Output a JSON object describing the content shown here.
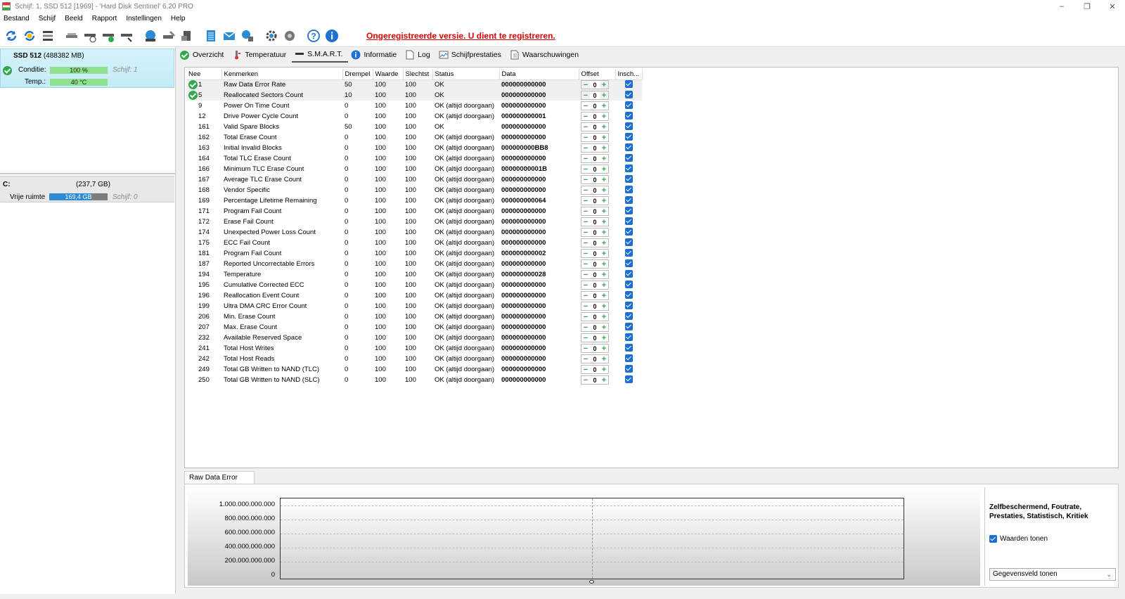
{
  "window": {
    "title": "Schijf: 1, SSD 512 [1969]  -  'Hard Disk Sentinel' 6.20 PRO",
    "controls": [
      "–",
      "❐",
      "✕"
    ]
  },
  "menu": [
    "Bestand",
    "Schijf",
    "Beeld",
    "Rapport",
    "Instellingen",
    "Help"
  ],
  "toolbar": {
    "icons": [
      "refresh-icon",
      "refresh-all-icon",
      "disk-list-icon",
      "disk-gray-icon",
      "disk-clock-icon",
      "disk-check-icon",
      "disk-arrow-icon",
      "globe-disk-icon",
      "disk-tools-icon",
      "disk-stack-icon",
      "notepad-icon",
      "mail-icon",
      "network-icon",
      "gear-icon",
      "settings-speaker-icon",
      "help-icon",
      "info-icon"
    ],
    "registration_warning": "Ongeregistreerde versie. U dient te registreren."
  },
  "left": {
    "disk": {
      "name": "SSD 512",
      "size": "(488382 MB)",
      "condition_label": "Conditie:",
      "condition_value": "100 %",
      "condition_disk": "Schijf: 1",
      "temp_label": "Temp.:",
      "temp_value": "40 °C"
    },
    "volume": {
      "letter": "C:",
      "size": "(237,7 GB)",
      "free_label": "Vrije ruimte",
      "free_value": "169,4 GB",
      "free_fraction": 0.713,
      "disk": "Schijf: 0"
    }
  },
  "tabs": [
    {
      "label": "Overzicht",
      "icon": "check-icon"
    },
    {
      "label": "Temperatuur",
      "icon": "thermometer-icon"
    },
    {
      "label": "S.M.A.R.T.",
      "icon": "smart-icon"
    },
    {
      "label": "Informatie",
      "icon": "info-icon"
    },
    {
      "label": "Log",
      "icon": "log-icon"
    },
    {
      "label": "Schijfprestaties",
      "icon": "performance-icon"
    },
    {
      "label": "Waarschuwingen",
      "icon": "warning-doc-icon"
    }
  ],
  "smart": {
    "headers": [
      "Nee",
      "Kenmerken",
      "Drempel",
      "Waarde",
      "Slechtst",
      "Status",
      "Data",
      "Offset",
      "Insch..."
    ],
    "rows": [
      {
        "id": "1",
        "name": "Raw Data Error Rate",
        "threshold": "50",
        "value": "100",
        "worst": "100",
        "status": "OK",
        "data": "000000000000",
        "offset": "0",
        "icon": true
      },
      {
        "id": "5",
        "name": "Reallocated Sectors Count",
        "threshold": "10",
        "value": "100",
        "worst": "100",
        "status": "OK",
        "data": "000000000000",
        "offset": "0",
        "icon": true
      },
      {
        "id": "9",
        "name": "Power On Time Count",
        "threshold": "0",
        "value": "100",
        "worst": "100",
        "status": "OK (altijd doorgaan)",
        "data": "000000000000",
        "offset": "0"
      },
      {
        "id": "12",
        "name": "Drive Power Cycle Count",
        "threshold": "0",
        "value": "100",
        "worst": "100",
        "status": "OK (altijd doorgaan)",
        "data": "000000000001",
        "offset": "0"
      },
      {
        "id": "161",
        "name": "Valid Spare Blocks",
        "threshold": "50",
        "value": "100",
        "worst": "100",
        "status": "OK",
        "data": "000000000000",
        "offset": "0"
      },
      {
        "id": "162",
        "name": "Total Erase Count",
        "threshold": "0",
        "value": "100",
        "worst": "100",
        "status": "OK (altijd doorgaan)",
        "data": "000000000000",
        "offset": "0"
      },
      {
        "id": "163",
        "name": "Initial Invalid Blocks",
        "threshold": "0",
        "value": "100",
        "worst": "100",
        "status": "OK (altijd doorgaan)",
        "data": "000000000BB8",
        "offset": "0"
      },
      {
        "id": "164",
        "name": "Total TLC Erase Count",
        "threshold": "0",
        "value": "100",
        "worst": "100",
        "status": "OK (altijd doorgaan)",
        "data": "000000000000",
        "offset": "0"
      },
      {
        "id": "166",
        "name": "Minimum TLC Erase Count",
        "threshold": "0",
        "value": "100",
        "worst": "100",
        "status": "OK (altijd doorgaan)",
        "data": "00000000001B",
        "offset": "0"
      },
      {
        "id": "167",
        "name": "Average TLC Erase Count",
        "threshold": "0",
        "value": "100",
        "worst": "100",
        "status": "OK (altijd doorgaan)",
        "data": "000000000000",
        "offset": "0"
      },
      {
        "id": "168",
        "name": "Vendor Specific",
        "threshold": "0",
        "value": "100",
        "worst": "100",
        "status": "OK (altijd doorgaan)",
        "data": "000000000000",
        "offset": "0"
      },
      {
        "id": "169",
        "name": "Percentage Lifetime Remaining",
        "threshold": "0",
        "value": "100",
        "worst": "100",
        "status": "OK (altijd doorgaan)",
        "data": "000000000064",
        "offset": "0"
      },
      {
        "id": "171",
        "name": "Program Fail Count",
        "threshold": "0",
        "value": "100",
        "worst": "100",
        "status": "OK (altijd doorgaan)",
        "data": "000000000000",
        "offset": "0"
      },
      {
        "id": "172",
        "name": "Erase Fail Count",
        "threshold": "0",
        "value": "100",
        "worst": "100",
        "status": "OK (altijd doorgaan)",
        "data": "000000000000",
        "offset": "0"
      },
      {
        "id": "174",
        "name": "Unexpected Power Loss Count",
        "threshold": "0",
        "value": "100",
        "worst": "100",
        "status": "OK (altijd doorgaan)",
        "data": "000000000000",
        "offset": "0"
      },
      {
        "id": "175",
        "name": "ECC Fail Count",
        "threshold": "0",
        "value": "100",
        "worst": "100",
        "status": "OK (altijd doorgaan)",
        "data": "000000000000",
        "offset": "0"
      },
      {
        "id": "181",
        "name": "Program Fail Count",
        "threshold": "0",
        "value": "100",
        "worst": "100",
        "status": "OK (altijd doorgaan)",
        "data": "000000000002",
        "offset": "0"
      },
      {
        "id": "187",
        "name": "Reported Uncorrectable Errors",
        "threshold": "0",
        "value": "100",
        "worst": "100",
        "status": "OK (altijd doorgaan)",
        "data": "000000000000",
        "offset": "0"
      },
      {
        "id": "194",
        "name": "Temperature",
        "threshold": "0",
        "value": "100",
        "worst": "100",
        "status": "OK (altijd doorgaan)",
        "data": "000000000028",
        "offset": "0"
      },
      {
        "id": "195",
        "name": "Cumulative Corrected ECC",
        "threshold": "0",
        "value": "100",
        "worst": "100",
        "status": "OK (altijd doorgaan)",
        "data": "000000000000",
        "offset": "0"
      },
      {
        "id": "196",
        "name": "Reallocation Event Count",
        "threshold": "0",
        "value": "100",
        "worst": "100",
        "status": "OK (altijd doorgaan)",
        "data": "000000000000",
        "offset": "0"
      },
      {
        "id": "199",
        "name": "Ultra DMA CRC Error Count",
        "threshold": "0",
        "value": "100",
        "worst": "100",
        "status": "OK (altijd doorgaan)",
        "data": "000000000000",
        "offset": "0"
      },
      {
        "id": "206",
        "name": "Min. Erase Count",
        "threshold": "0",
        "value": "100",
        "worst": "100",
        "status": "OK (altijd doorgaan)",
        "data": "000000000000",
        "offset": "0"
      },
      {
        "id": "207",
        "name": "Max. Erase Count",
        "threshold": "0",
        "value": "100",
        "worst": "100",
        "status": "OK (altijd doorgaan)",
        "data": "000000000000",
        "offset": "0"
      },
      {
        "id": "232",
        "name": "Available Reserved Space",
        "threshold": "0",
        "value": "100",
        "worst": "100",
        "status": "OK (altijd doorgaan)",
        "data": "000000000000",
        "offset": "0"
      },
      {
        "id": "241",
        "name": "Total Host Writes",
        "threshold": "0",
        "value": "100",
        "worst": "100",
        "status": "OK (altijd doorgaan)",
        "data": "000000000000",
        "offset": "0"
      },
      {
        "id": "242",
        "name": "Total Host Reads",
        "threshold": "0",
        "value": "100",
        "worst": "100",
        "status": "OK (altijd doorgaan)",
        "data": "000000000000",
        "offset": "0"
      },
      {
        "id": "249",
        "name": "Total GB Written to NAND (TLC)",
        "threshold": "0",
        "value": "100",
        "worst": "100",
        "status": "OK (altijd doorgaan)",
        "data": "000000000000",
        "offset": "0"
      },
      {
        "id": "250",
        "name": "Total GB Written to NAND (SLC)",
        "threshold": "0",
        "value": "100",
        "worst": "100",
        "status": "OK (altijd doorgaan)",
        "data": "000000000000",
        "offset": "0"
      }
    ]
  },
  "graph": {
    "tab_label": "Raw Data Error Rate",
    "legend_title": "Zelfbeschermend, Foutrate, Prestaties, Statistisch, Kritiek",
    "show_values_label": "Waarden tonen",
    "select_value": "Gegevensveld tonen"
  },
  "chart_data": {
    "type": "line",
    "title": "",
    "xlabel": "",
    "ylabel": "",
    "yticks": [
      "1.000.000.000.000",
      "800.000.000.000",
      "600.000.000.000",
      "400.000.000.000",
      "200.000.000.000",
      "0"
    ],
    "ylim": [
      0,
      1000000000000
    ],
    "grid": true,
    "series": [
      {
        "values": [
          0
        ]
      }
    ]
  }
}
